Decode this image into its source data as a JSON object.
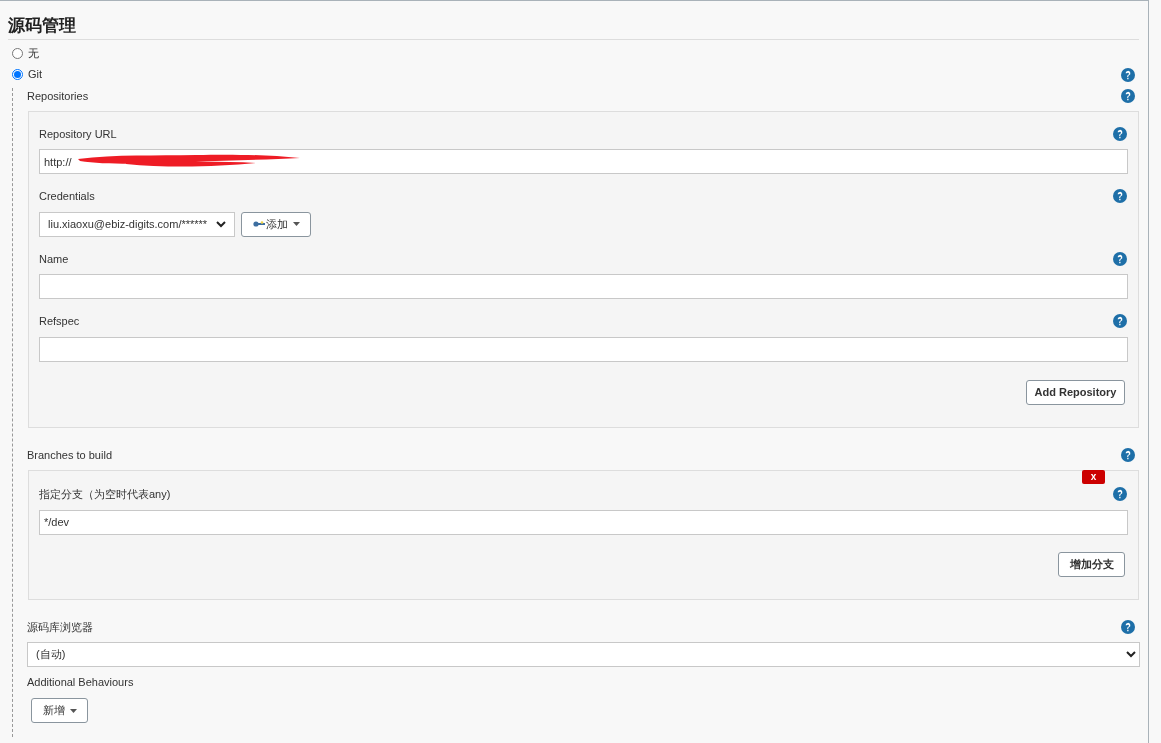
{
  "section_title": "源码管理",
  "scm_options": [
    {
      "label": "无",
      "selected": false
    },
    {
      "label": "Git",
      "selected": true
    }
  ],
  "repositories": {
    "label": "Repositories",
    "fields": [
      {
        "kind": "text",
        "label": "Repository URL",
        "value": "http://",
        "redacted": true
      },
      {
        "kind": "credentials",
        "label": "Credentials",
        "value": "liu.xiaoxu@ebiz-digits.com/******",
        "add_button": "添加"
      },
      {
        "kind": "text",
        "label": "Name"
      },
      {
        "kind": "text",
        "label": "Refspec"
      }
    ],
    "add_button": "Add Repository"
  },
  "branches": {
    "label": "Branches to build",
    "delete_button": "x",
    "field_label": "指定分支（为空时代表any)",
    "value": "*/dev",
    "add_button": "增加分支"
  },
  "browser": {
    "label": "源码库浏览器",
    "value": "(自动)"
  },
  "behaviours": {
    "label": "Additional Behaviours",
    "add_button": "新增"
  }
}
